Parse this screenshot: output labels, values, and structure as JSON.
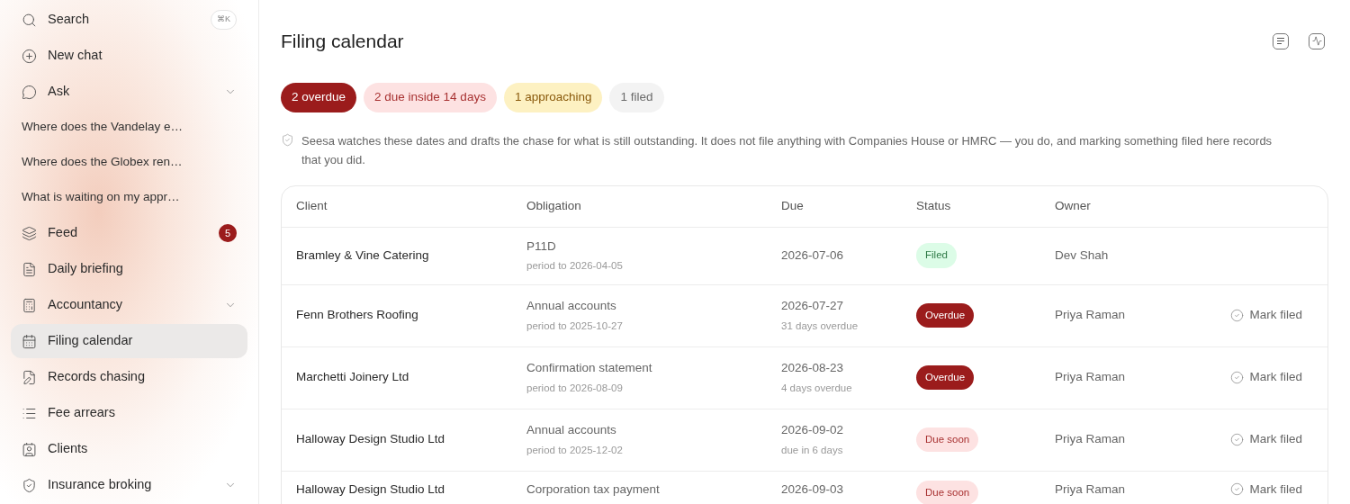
{
  "sidebar": {
    "items": [
      {
        "kind": "nav",
        "label": "Search",
        "shortcut": "⌘K",
        "selected": false
      },
      {
        "kind": "nav",
        "label": "New chat",
        "selected": false
      },
      {
        "kind": "nav",
        "label": "Ask",
        "expandable": true,
        "selected": false
      },
      {
        "kind": "chat",
        "label": "Where does the Vandelay e…"
      },
      {
        "kind": "chat",
        "label": "Where does the Globex ren…"
      },
      {
        "kind": "chat",
        "label": "What is waiting on my appr…"
      },
      {
        "kind": "nav",
        "label": "Feed",
        "badge": "5",
        "selected": false
      },
      {
        "kind": "nav",
        "label": "Daily briefing",
        "selected": false
      },
      {
        "kind": "nav",
        "label": "Accountancy",
        "expandable": true,
        "selected": false
      },
      {
        "kind": "nav",
        "label": "Filing calendar",
        "selected": true
      },
      {
        "kind": "nav",
        "label": "Records chasing",
        "selected": false
      },
      {
        "kind": "nav",
        "label": "Fee arrears",
        "selected": false
      },
      {
        "kind": "nav",
        "label": "Clients",
        "selected": false
      },
      {
        "kind": "nav",
        "label": "Insurance broking",
        "expandable": true,
        "selected": false
      }
    ]
  },
  "page": {
    "title": "Filing calendar",
    "chips": [
      {
        "kind": "overdue",
        "label": "2 overdue"
      },
      {
        "kind": "due_soon",
        "label": "2 due inside 14 days"
      },
      {
        "kind": "approaching",
        "label": "1 approaching"
      },
      {
        "kind": "filed",
        "label": "1 filed"
      }
    ],
    "note": "Seesa watches these dates and drafts the chase for what is still outstanding. It does not file anything with Companies House or HMRC — you do, and marking something filed here records that you did."
  },
  "table": {
    "columns": [
      "Client",
      "Obligation",
      "Due",
      "Status",
      "Owner"
    ],
    "rows": [
      {
        "client": "Bramley & Vine Catering",
        "obligation": "P11D",
        "period": "period to 2026-04-05",
        "due": "2026-07-06",
        "status": {
          "kind": "filed",
          "label": "Filed"
        },
        "owner": "Dev Shah"
      },
      {
        "client": "Fenn Brothers Roofing",
        "obligation": "Annual accounts",
        "period": "period to 2025-10-27",
        "due": "2026-07-27",
        "due_note": "31 days overdue",
        "status": {
          "kind": "overdue",
          "label": "Overdue"
        },
        "owner": "Priya Raman",
        "action": "Mark filed"
      },
      {
        "client": "Marchetti Joinery Ltd",
        "obligation": "Confirmation statement",
        "period": "period to 2026-08-09",
        "due": "2026-08-23",
        "due_note": "4 days overdue",
        "status": {
          "kind": "overdue",
          "label": "Overdue"
        },
        "owner": "Priya Raman",
        "action": "Mark filed"
      },
      {
        "client": "Halloway Design Studio Ltd",
        "obligation": "Annual accounts",
        "period": "period to 2025-12-02",
        "due": "2026-09-02",
        "due_note": "due in 6 days",
        "status": {
          "kind": "due_soon",
          "label": "Due soon"
        },
        "owner": "Priya Raman",
        "action": "Mark filed"
      },
      {
        "client": "Halloway Design Studio Ltd",
        "obligation": "Corporation tax payment",
        "due": "2026-09-03",
        "status": {
          "kind": "due_soon",
          "label": "Due soon"
        },
        "owner": "Priya Raman",
        "action": "Mark filed"
      }
    ]
  }
}
